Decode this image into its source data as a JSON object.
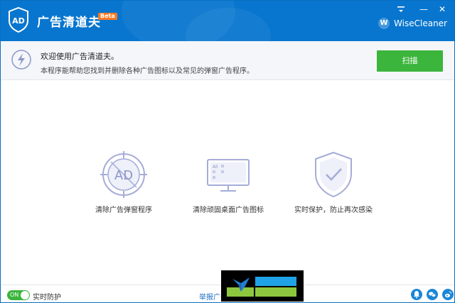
{
  "app": {
    "title": "广告清道夫",
    "badge": "Beta",
    "logo_text": "AD",
    "brand": "WiseCleaner",
    "brand_mark": "W"
  },
  "window_controls": {
    "menu_icon": "menu-icon",
    "minimize_label": "—",
    "close_label": "✕"
  },
  "banner": {
    "title": "欢迎使用广告清道夫。",
    "description": "本程序能帮助您找到并删除各种广告图标以及常见的弹窗广告程序。",
    "scan_button": "扫描"
  },
  "features": [
    {
      "label": "清除广告弹窗程序",
      "icon_text": "AD",
      "icon": "ad-target-icon"
    },
    {
      "label": "清除顽固桌面广告图标",
      "icon_text": "All",
      "icon": "monitor-icon"
    },
    {
      "label": "实时保护，防止再次感染",
      "icon": "shield-check-icon"
    }
  ],
  "bottom": {
    "toggle_text": "ON",
    "toggle_label": "实时防护",
    "toggle_state": true,
    "report_link": "举报广告"
  },
  "colors": {
    "titlebar": "#0876cf",
    "accent_green": "#3bb53b",
    "icon_lavender": "#a5acd9",
    "link_blue": "#1b6fc2"
  }
}
